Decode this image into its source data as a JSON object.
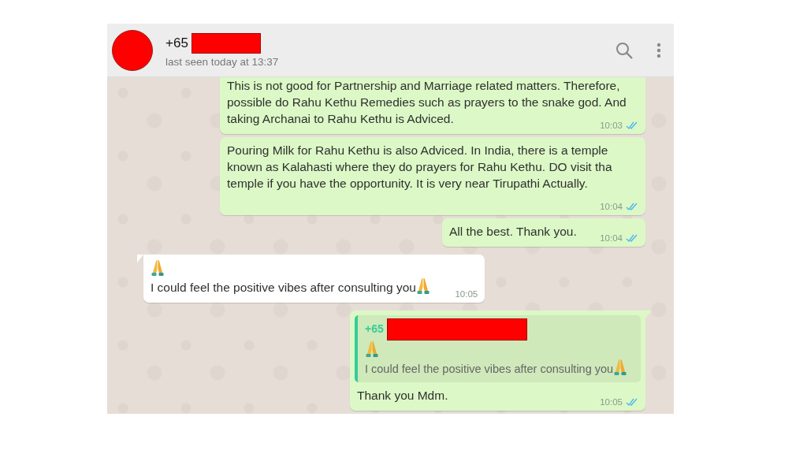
{
  "header": {
    "avatar": {
      "kind": "redacted"
    },
    "name_prefix": "+65",
    "name_redacted": true,
    "status": "last seen today at 13:37"
  },
  "messages": [
    {
      "outgoing": true,
      "tail": false,
      "text": "This is not good for Partnership and Marriage related matters. Therefore, possible do Rahu Kethu Remedies such as prayers to the snake god. And taking Archanai to Rahu Kethu is Adviced.",
      "time": "10:03",
      "read": true
    },
    {
      "outgoing": true,
      "tail": false,
      "text": "Pouring Milk for Rahu Kethu is also Adviced. In India, there is a temple known as Kalahasti where they do prayers for Rahu Kethu. DO visit tha temple if you have the opportunity. It is very near Tirupathi Actually.",
      "time": "10:04",
      "read": true
    },
    {
      "outgoing": true,
      "tail": false,
      "text": "All the best. Thank you.",
      "time": "10:04",
      "read": true
    },
    {
      "outgoing": false,
      "tail": true,
      "emoji_line": true,
      "text": "I could feel the positive vibes after consulting you",
      "trailing_emoji": true,
      "time": "10:05"
    },
    {
      "outgoing": true,
      "tail": true,
      "quote": {
        "author_prefix": "+65",
        "author_redacted": true,
        "emoji_line": true,
        "text": "I could feel the positive vibes after consulting you",
        "trailing_emoji": true
      },
      "text": "Thank you Mdm.",
      "time": "10:05",
      "read": true
    }
  ]
}
